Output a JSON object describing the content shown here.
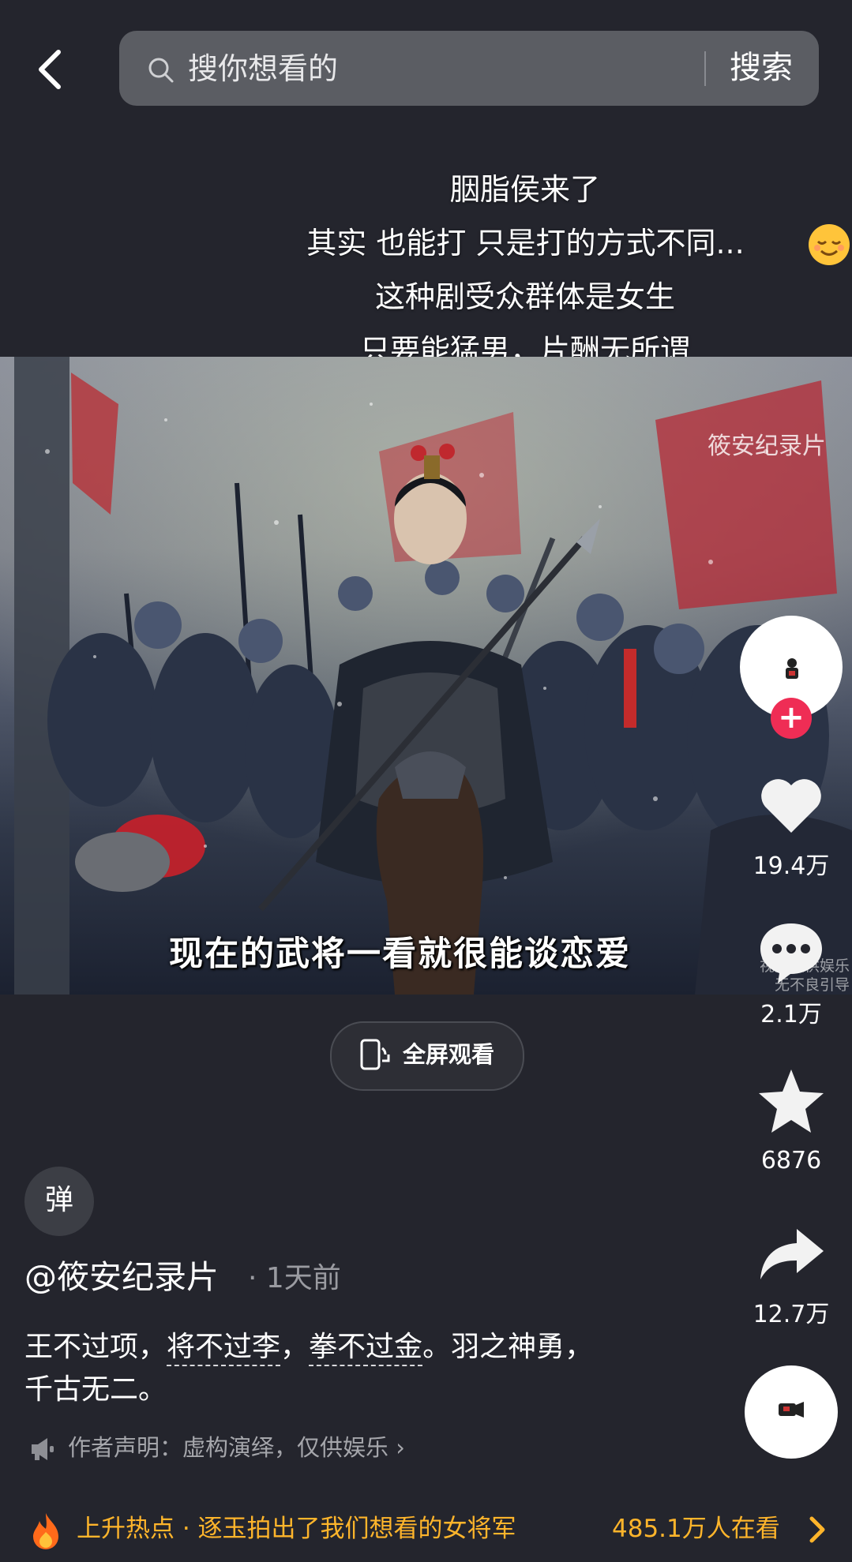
{
  "search": {
    "placeholder": "搜你想看的",
    "button": "搜索"
  },
  "overlay_text": [
    "胭脂侯来了",
    "其实 也能打 只是打的方式不同...",
    "这种剧受众群体是女生",
    "只要能猛男，片酬无所谓"
  ],
  "video": {
    "watermark": "筱安纪录片",
    "subtitle": "现在的武将一看就很能谈恋爱",
    "note_line1": "视频仅供娱乐",
    "note_line2": "无不良引导"
  },
  "fullscreen_label": "全屏观看",
  "actions": {
    "likes": "19.4万",
    "comments": "2.1万",
    "favorites": "6876",
    "shares": "12.7万"
  },
  "danmaku_label": "弹",
  "author": {
    "name": "@筱安纪录片",
    "time": "· 1天前"
  },
  "caption": {
    "part1": "王不过项，",
    "link1": "将不过李",
    "part2": "，",
    "link2": "拳不过金",
    "part3": "。羽之神勇，",
    "line2": "千古无二。"
  },
  "declaration": "作者声明：虚构演绎，仅供娱乐 ›",
  "hotspot": {
    "text": "上升热点 · 逐玉拍出了我们想看的女将军",
    "count": "485.1万人在看"
  },
  "colors": {
    "background": "#24252d",
    "accent_pink": "#ef2d55",
    "hot_orange": "#ffb52b"
  }
}
